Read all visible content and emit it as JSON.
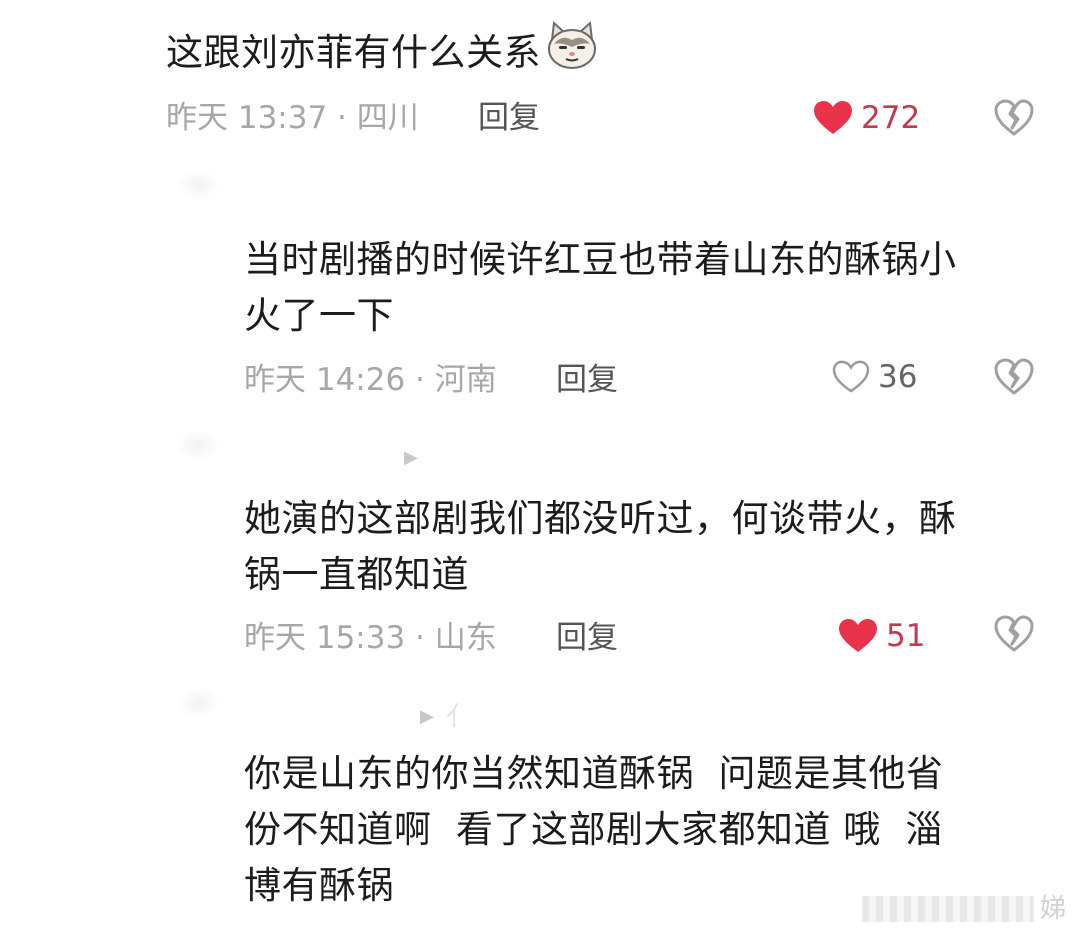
{
  "comments": [
    {
      "text": "这跟刘亦菲有什么关系",
      "emoji_icon": "cat-face-emoji",
      "time_location": "昨天 13:37 · 四川",
      "reply_label": "回复",
      "likes": "272",
      "liked": true
    },
    {
      "text_lines": [
        "当时剧播的时候许红豆也带着山东的酥锅小",
        "火了一下"
      ],
      "time_location": "昨天 14:26 · 河南",
      "reply_label": "回复",
      "likes": "36",
      "liked": false
    },
    {
      "text_lines": [
        "她演的这部剧我们都没听过，何谈带火，酥",
        "锅一直都知道"
      ],
      "time_location": "昨天 15:33 · 山东",
      "reply_label": "回复",
      "likes": "51",
      "liked": true
    },
    {
      "text_lines": [
        "你是山东的你当然知道酥锅  问题是其他省",
        "份不知道啊  看了这部剧大家都知道 哦  淄",
        "博有酥锅"
      ]
    }
  ],
  "ghost_marks": [
    "▶",
    "▶",
    "亻"
  ],
  "watermark": "娣",
  "colors": {
    "like_active": "#e8334a",
    "like_inactive": "#9a9a9a",
    "meta_text": "#a7a7a7"
  }
}
